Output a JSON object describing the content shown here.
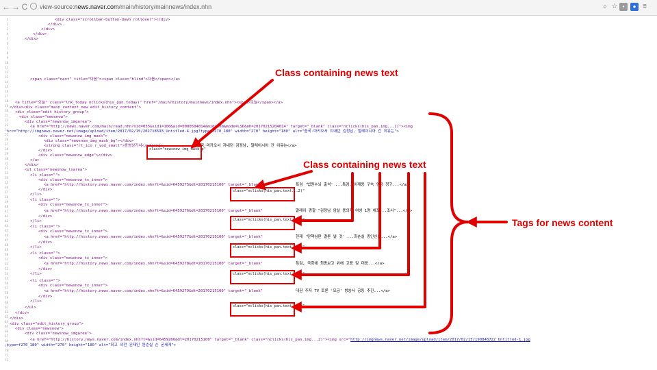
{
  "browser": {
    "back_glyph": "←",
    "forward_glyph": "→",
    "reload_glyph": "C",
    "url_prefix": "view-source:",
    "url_host": "news.naver.com",
    "url_path": "/main/history/mainnews/index.nhn",
    "icons": [
      "search-icon",
      "star-icon",
      "extension-icon",
      "extension-icon",
      "menu-icon"
    ]
  },
  "annotations": {
    "callout_top": "Class containing news text",
    "callout_middle": "Class containing news text",
    "callout_right": "Tags for news content",
    "accent_color": "#e00000"
  },
  "highlights": {
    "mask_class": "class=\"newsnow_img_mask_p\"",
    "text_classes": [
      "class=\"nclicks(his_pan.text...2)\"",
      "class=\"nclicks(his_pan.text...3)\"",
      "class=\"nclicks(his_pan.text...4)\"",
      "class=\"nclicks(his_pan.text...5)\"",
      "class=\"nclicks(his_pan.text...6)\""
    ]
  },
  "source": {
    "line_numbers": [
      "1",
      "2",
      "3",
      "4",
      "5",
      "6",
      "7",
      "8",
      "9",
      "10",
      "11",
      "12",
      "13",
      "14",
      "15",
      "16",
      "17",
      "18",
      "19",
      "20",
      "21",
      "22",
      "23",
      "24",
      "25",
      "26",
      "27",
      "28",
      "29",
      "30",
      "31",
      "32",
      "33",
      "34",
      "35",
      "36",
      "37",
      "38",
      "39",
      "40",
      "41",
      "42",
      "43",
      "44",
      "45",
      "46",
      "47",
      "48",
      "49",
      "50",
      "51",
      "52",
      "53",
      "54",
      "55",
      "56",
      "57",
      "58",
      "59",
      "60",
      "61",
      "62",
      "63",
      "64",
      "65",
      "66",
      "67",
      "68",
      "69",
      "70",
      "71",
      "72"
    ],
    "lines": {
      "l1": "<div class=\"scrollbar-button-down rollover\"></div>",
      "l2": "</div>",
      "l3": "</div>",
      "l4": "</div>",
      "l5": "</div>",
      "l6": "<span class=\"next\" title=\"다음\"><span class=\"blind\">다음</span></a>",
      "l7": "<a title=\"오늘\" class=\"lnk_today nclicks(his_pan.today)\" href=\"/main/history/mainnews/index.nhn\"><span>오늘</span></a>",
      "l8": "</div><div class=\"main_content_new edit_history_content\">",
      "l9": "<div class=\"edit_history_group\">",
      "l10": "<div class=\"newsnow\">",
      "l11": "<div class=\"newsnow_imgarea\">",
      "l12": "<a href=\"http://news.naver.com/main/read.nhn?oid=055&sid1=100&aid=0000504014&mid=shm&mode=LSD&nh=20170215204014\" target=\"_blank\" class=\"nclicks(his_pan.img...1)\"><img",
      "l13": "src=\"http://imgnews.naver.net/image/upload/item/2017/02/15/202718593_Untitled-4.jpg?type=f270_180\" width=\"270\" height=\"180\" alt=\"중국·마카오서 지내던 김정남, 말레이시아 간 이유는\">",
      "l14": "<div class=\"newsnow_img_mask\">",
      "l15": "<div class=\"newsnow_img_mask_bg\"></div>",
      "l16": "<strong class=\"rt_ico r_vod_small\">동영상기사</strong>",
      "l16_tail": "중국·마카오서 지내던 김정남, 말레이시아 간 이유는</a>",
      "l17": "</div>",
      "l18": "<div class=\"newsnow_edge\"></div>",
      "l19": "</a>",
      "l20": "</div>",
      "l21": "<ul class=\"newsnow_txarea\">",
      "l22": "<li class=\"\">",
      "l23": "<div class=\"newsnow_tx_inner\">",
      "l24": "<a href=\"http://history.news.naver.com/index.nhn?t=&sid=6459275&dt=20170215100\" target=\"_blank\"",
      "l24_tail": "특검 '법원수뇌 출석' ...특검, 이재용 구속 영장 청구...</a>",
      "l25": "</div>",
      "l26": "</li>",
      "l27": "<li class=\"\">",
      "l28": "<div class=\"newsnow_tx_inner\">",
      "l29": "<a href=\"http://history.news.naver.com/index.nhn?t=&sid=6459276&dt=20170215100\" target=\"_blank\"",
      "l29_tail": "말레이 경찰 \"김정남 암살 용의자 여성 1명 체포...조사\"...</a>",
      "l30": "</div>",
      "l31": "</li>",
      "l32": "<li class=\"\">",
      "l33": "<div class=\"newsnow_tx_inner\">",
      "l34": "<a href=\"http://history.news.naver.com/index.nhn?t=&sid=6459277&dt=20170215100\" target=\"_blank\"",
      "l34_tail": "헌재 '탄핵심판 결론 낼 것' ...최순실 증인신문...</a>",
      "l35": "</div>",
      "l36": "</li>",
      "l37": "<li class=\"\">",
      "l38": "<div class=\"newsnow_tx_inner\">",
      "l39": "<a href=\"http://history.news.naver.com/index.nhn?t=&sid=6459278&dt=20170215100\" target=\"_blank\"",
      "l39_tail": "특검, 국회에 최종보고 위해 고용 및 대응...</a>",
      "l40": "</div>",
      "l41": "</li>",
      "l42": "<li class=\"\">",
      "l43": "<div class=\"newsnow_tx_inner\">",
      "l44": "<a href=\"http://history.news.naver.com/index.nhn?t=&sid=6459279&dt=20170215100\" target=\"_blank\"",
      "l44_tail": "대권 주자 TV 토론 '모금' 방송사 공동 추진...</a>",
      "l45": "</div>",
      "l46": "</li>",
      "l47": "</ul>",
      "l48": "</div>",
      "l49": "</div>",
      "l50": "<div class=\"edit_history_group\">",
      "l51": "<div class=\"newsnow\">",
      "l52": "<div class=\"newsnow_imgarea\">",
      "l53": "<a href=\"http://history.news.naver.com/index.nhn?t=&sid=6459266&dt=20170215100\" target=\"_blank\" class=\"nclicks(his_pan.img...2)\"><img src=\"",
      "l53_link": "http://imgnews.naver.net/image/upload/item/2017/02/15/190848722_Untitled-1.jpg",
      "l54": "type=f270_180\" width=\"270\" height=\"180\" alt=\"최고 의전 문재인 원순실 손 굳세게\">"
    }
  }
}
